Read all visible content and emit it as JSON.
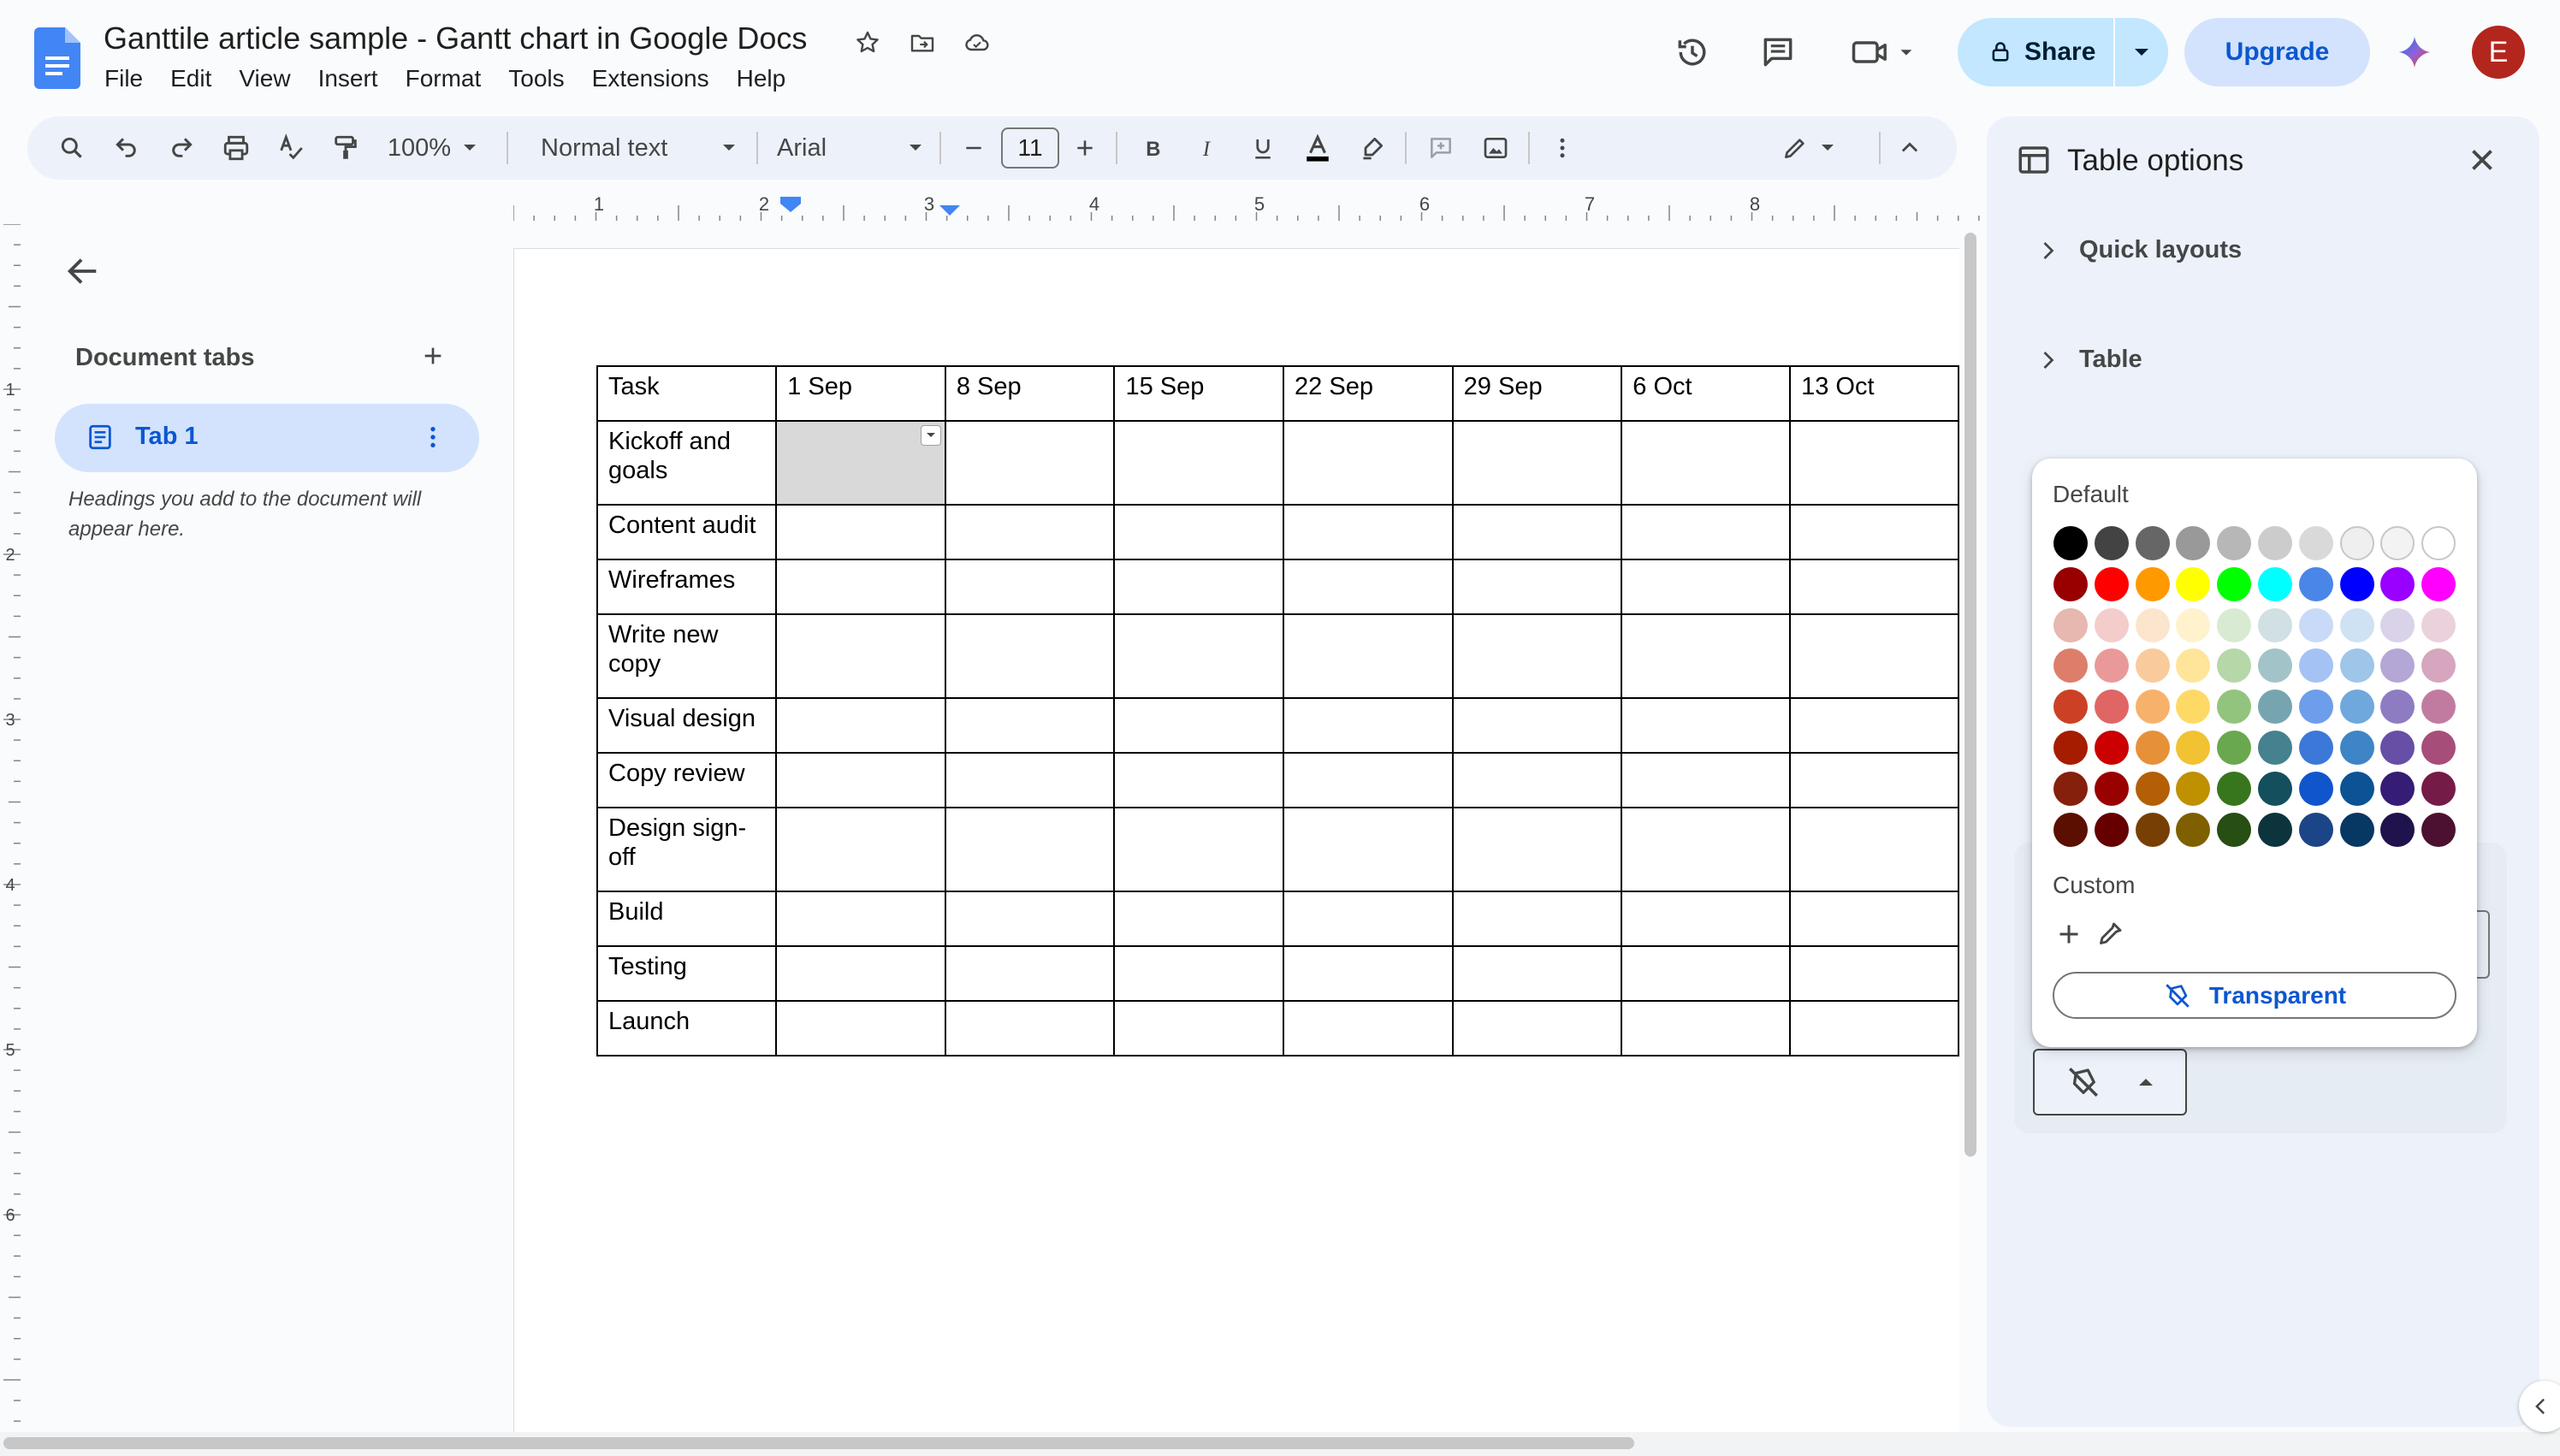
{
  "app": {
    "doc_title": "Ganttile article sample - Gantt chart in Google Docs",
    "menus": [
      "File",
      "Edit",
      "View",
      "Insert",
      "Format",
      "Tools",
      "Extensions",
      "Help"
    ],
    "share_label": "Share",
    "upgrade_label": "Upgrade",
    "avatar_initial": "E",
    "icons": [
      "docs-logo-icon",
      "star-icon",
      "move-to-folder-icon",
      "cloud-saved-icon",
      "version-history-icon",
      "comments-icon",
      "meet-icon",
      "lock-icon",
      "gemini-icon"
    ]
  },
  "toolbar": {
    "zoom": "100%",
    "style": "Normal text",
    "font": "Arial",
    "font_size": "11"
  },
  "ruler": {
    "numbers": [
      "1",
      "2",
      "3",
      "4",
      "5",
      "6",
      "7",
      "8"
    ],
    "vertical_numbers": [
      "1",
      "2",
      "3",
      "4",
      "5",
      "6"
    ]
  },
  "left_panel": {
    "title": "Document tabs",
    "tab_label": "Tab 1",
    "hint": "Headings you add to the document will appear here."
  },
  "table": {
    "header": [
      "Task",
      "1 Sep",
      "8 Sep",
      "15 Sep",
      "22 Sep",
      "29 Sep",
      "6 Oct",
      "13 Oct"
    ],
    "rows": [
      {
        "task": "Kickoff and goals",
        "size": "tall"
      },
      {
        "task": "Content audit",
        "size": "short"
      },
      {
        "task": "Wireframes",
        "size": "short"
      },
      {
        "task": "Write new copy",
        "size": "tall"
      },
      {
        "task": "Visual design",
        "size": "short"
      },
      {
        "task": "Copy review",
        "size": "short"
      },
      {
        "task": "Design sign-off",
        "size": "tall"
      },
      {
        "task": "Build",
        "size": "short"
      },
      {
        "task": "Testing",
        "size": "short"
      },
      {
        "task": "Launch",
        "size": "short"
      }
    ]
  },
  "sidebar": {
    "title": "Table options",
    "sections": [
      "Quick layouts",
      "Table"
    ]
  },
  "palette": {
    "default_label": "Default",
    "custom_label": "Custom",
    "transparent_label": "Transparent",
    "rows": [
      [
        "#000000",
        "#434343",
        "#666666",
        "#999999",
        "#b7b7b7",
        "#cccccc",
        "#d9d9d9",
        "#efefef",
        "#f3f3f3",
        "#ffffff"
      ],
      [
        "#980000",
        "#ff0000",
        "#ff9900",
        "#ffff00",
        "#00ff00",
        "#00ffff",
        "#4a86e8",
        "#0000ff",
        "#9900ff",
        "#ff00ff"
      ],
      [
        "#e6b8af",
        "#f4cccc",
        "#fce5cd",
        "#fff2cc",
        "#d9ead3",
        "#d0e0e3",
        "#c9daf8",
        "#cfe2f3",
        "#d9d2e9",
        "#ead1dc"
      ],
      [
        "#dd7e6b",
        "#ea9999",
        "#f9cb9c",
        "#ffe599",
        "#b6d7a8",
        "#a2c4c9",
        "#a4c2f4",
        "#9fc5e8",
        "#b4a7d6",
        "#d5a6bd"
      ],
      [
        "#cc4125",
        "#e06666",
        "#f6b26b",
        "#ffd966",
        "#93c47d",
        "#76a5af",
        "#6d9eeb",
        "#6fa8dc",
        "#8e7cc3",
        "#c27ba0"
      ],
      [
        "#a61c00",
        "#cc0000",
        "#e69138",
        "#f1c232",
        "#6aa84f",
        "#45818e",
        "#3c78d8",
        "#3d85c6",
        "#674ea7",
        "#a64d79"
      ],
      [
        "#85200c",
        "#990000",
        "#b45f06",
        "#bf9000",
        "#38761d",
        "#134f5c",
        "#1155cc",
        "#0b5394",
        "#351c75",
        "#741b47"
      ],
      [
        "#5b0f00",
        "#660000",
        "#783f04",
        "#7f6000",
        "#274e13",
        "#0c343d",
        "#1c4587",
        "#073763",
        "#20124d",
        "#4c1130"
      ]
    ]
  },
  "colors": {
    "accent_blue": "#0b57d0",
    "share_bg": "#c2e7ff",
    "upgrade_bg": "#d3e3fd",
    "selected_cell": "#d9d9d9",
    "avatar_bg": "#b3261e"
  }
}
